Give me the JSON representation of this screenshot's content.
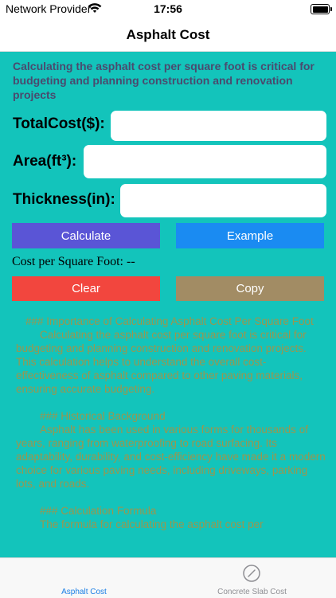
{
  "status": {
    "carrier": "Network Provider",
    "time": "17:56"
  },
  "nav": {
    "title": "Asphalt Cost"
  },
  "intro": "Calculating the asphalt cost per square foot is critical for budgeting and planning construction and renovation projects",
  "form": {
    "total_cost_label": "TotalCost($):",
    "area_label": "Area(ft³):",
    "thickness_label": "Thickness(in):",
    "total_cost_value": "",
    "area_value": "",
    "thickness_value": ""
  },
  "buttons": {
    "calculate": "Calculate",
    "example": "Example",
    "clear": "Clear",
    "copy": "Copy"
  },
  "result": "Cost per Square Foot: --",
  "article": {
    "h1": "### Importance of Calculating Asphalt Cost Per Square Foot",
    "p1": "Calculating the asphalt cost per square foot is critical for budgeting and planning construction and renovation projects. This calculation helps to understand the overall cost-effectiveness of asphalt compared to other paving materials, ensuring accurate budgeting.",
    "h2": "### Historical Background",
    "p2": "Asphalt has been used in various forms for thousands of years, ranging from waterproofing to road surfacing. Its adaptability, durability, and cost-efficiency have made it a modern choice for various paving needs, including driveways, parking lots, and roads.",
    "h3": "### Calculation Formula",
    "p3": "The formula for calculating the asphalt cost per"
  },
  "tabs": {
    "asphalt": "Asphalt Cost",
    "slab": "Concrete Slab Cost"
  },
  "colors": {
    "background": "#13c4bb",
    "calculate": "#5a55d6",
    "example": "#1a8bf2",
    "clear": "#f2463e",
    "copy": "#a28c64",
    "active_tab": "#1a7fe6"
  }
}
